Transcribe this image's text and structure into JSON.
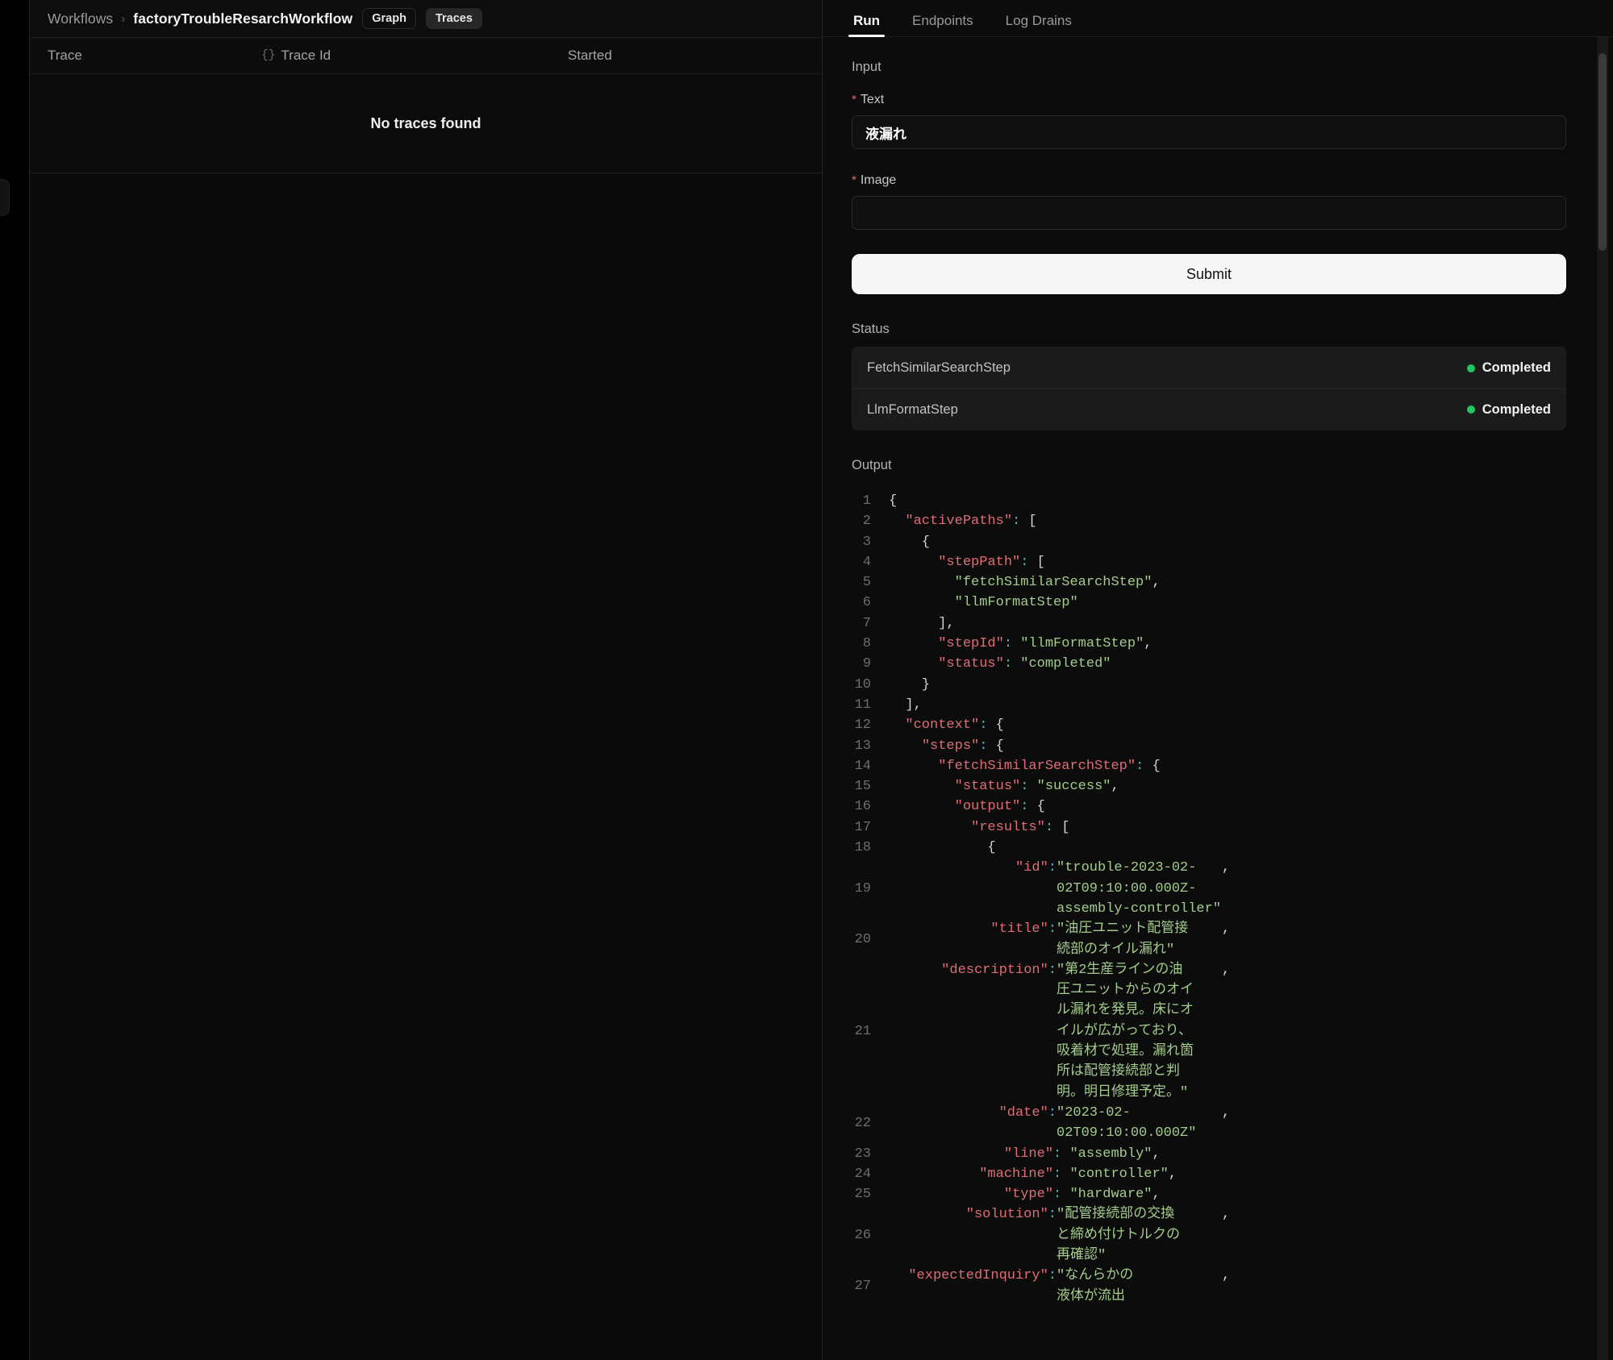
{
  "breadcrumb": {
    "root_label": "Workflows",
    "separator": "›",
    "current_label": "factoryTroubleResarchWorkflow",
    "graph_button": "Graph",
    "traces_button": "Traces"
  },
  "traces_table": {
    "columns": [
      "Trace",
      "Trace Id",
      "Started"
    ],
    "trace_id_prefix_icon": "{}",
    "empty_message": "No traces found"
  },
  "right_panel": {
    "tabs": [
      {
        "label": "Run",
        "active": true
      },
      {
        "label": "Endpoints",
        "active": false
      },
      {
        "label": "Log Drains",
        "active": false
      }
    ],
    "input_section_label": "Input",
    "fields": [
      {
        "label": "Text",
        "required_marker": "*",
        "value": "液漏れ",
        "placeholder": ""
      },
      {
        "label": "Image",
        "required_marker": "*",
        "value": "",
        "placeholder": ""
      }
    ],
    "submit_label": "Submit",
    "status_label": "Status",
    "status_rows": [
      {
        "step": "FetchSimilarSearchStep",
        "state": "Completed",
        "dot_color": "#22c55e"
      },
      {
        "step": "LlmFormatStep",
        "state": "Completed",
        "dot_color": "#22c55e"
      }
    ],
    "output_label": "Output"
  },
  "colors": {
    "accent_green": "#22c55e",
    "required_red": "#e06c75",
    "submit_bg": "#f7f7f7",
    "code_key": "#e06c75",
    "code_string": "#a3cc8c",
    "code_colon": "#56b6c2",
    "code_line_number": "#6e6e6e"
  },
  "output_code": {
    "language": "json",
    "lines": [
      {
        "n": "1",
        "segments": [
          {
            "t": "{",
            "c": "d"
          }
        ]
      },
      {
        "n": "2",
        "segments": [
          {
            "t": "  ",
            "c": "d"
          },
          {
            "t": "\"activePaths\"",
            "c": "k"
          },
          {
            "t": ":",
            "c": "p"
          },
          {
            "t": " [",
            "c": "d"
          }
        ]
      },
      {
        "n": "3",
        "segments": [
          {
            "t": "    {",
            "c": "d"
          }
        ]
      },
      {
        "n": "4",
        "segments": [
          {
            "t": "      ",
            "c": "d"
          },
          {
            "t": "\"stepPath\"",
            "c": "k"
          },
          {
            "t": ":",
            "c": "p"
          },
          {
            "t": " [",
            "c": "d"
          }
        ]
      },
      {
        "n": "5",
        "segments": [
          {
            "t": "        ",
            "c": "d"
          },
          {
            "t": "\"fetchSimilarSearchStep\"",
            "c": "s"
          },
          {
            "t": ",",
            "c": "d"
          }
        ]
      },
      {
        "n": "6",
        "segments": [
          {
            "t": "        ",
            "c": "d"
          },
          {
            "t": "\"llmFormatStep\"",
            "c": "s"
          }
        ]
      },
      {
        "n": "7",
        "segments": [
          {
            "t": "      ],",
            "c": "d"
          }
        ]
      },
      {
        "n": "8",
        "segments": [
          {
            "t": "      ",
            "c": "d"
          },
          {
            "t": "\"stepId\"",
            "c": "k"
          },
          {
            "t": ":",
            "c": "p"
          },
          {
            "t": " ",
            "c": "d"
          },
          {
            "t": "\"llmFormatStep\"",
            "c": "s"
          },
          {
            "t": ",",
            "c": "d"
          }
        ]
      },
      {
        "n": "9",
        "segments": [
          {
            "t": "      ",
            "c": "d"
          },
          {
            "t": "\"status\"",
            "c": "k"
          },
          {
            "t": ":",
            "c": "p"
          },
          {
            "t": " ",
            "c": "d"
          },
          {
            "t": "\"completed\"",
            "c": "s"
          }
        ]
      },
      {
        "n": "10",
        "segments": [
          {
            "t": "    }",
            "c": "d"
          }
        ]
      },
      {
        "n": "11",
        "segments": [
          {
            "t": "  ],",
            "c": "d"
          }
        ]
      },
      {
        "n": "12",
        "segments": [
          {
            "t": "  ",
            "c": "d"
          },
          {
            "t": "\"context\"",
            "c": "k"
          },
          {
            "t": ":",
            "c": "p"
          },
          {
            "t": " {",
            "c": "d"
          }
        ]
      },
      {
        "n": "13",
        "segments": [
          {
            "t": "    ",
            "c": "d"
          },
          {
            "t": "\"steps\"",
            "c": "k"
          },
          {
            "t": ":",
            "c": "p"
          },
          {
            "t": " {",
            "c": "d"
          }
        ]
      },
      {
        "n": "14",
        "segments": [
          {
            "t": "      ",
            "c": "d"
          },
          {
            "t": "\"fetchSimilarSearchStep\"",
            "c": "k"
          },
          {
            "t": ":",
            "c": "p"
          },
          {
            "t": " {",
            "c": "d"
          }
        ]
      },
      {
        "n": "15",
        "segments": [
          {
            "t": "        ",
            "c": "d"
          },
          {
            "t": "\"status\"",
            "c": "k"
          },
          {
            "t": ":",
            "c": "p"
          },
          {
            "t": " ",
            "c": "d"
          },
          {
            "t": "\"success\"",
            "c": "s"
          },
          {
            "t": ",",
            "c": "d"
          }
        ]
      },
      {
        "n": "16",
        "segments": [
          {
            "t": "        ",
            "c": "d"
          },
          {
            "t": "\"output\"",
            "c": "k"
          },
          {
            "t": ":",
            "c": "p"
          },
          {
            "t": " {",
            "c": "d"
          }
        ]
      },
      {
        "n": "17",
        "segments": [
          {
            "t": "          ",
            "c": "d"
          },
          {
            "t": "\"results\"",
            "c": "k"
          },
          {
            "t": ":",
            "c": "p"
          },
          {
            "t": " [",
            "c": "d"
          }
        ]
      },
      {
        "n": "18",
        "segments": [
          {
            "t": "            {",
            "c": "d"
          }
        ]
      }
    ],
    "wrapped_lines": [
      {
        "n": "19",
        "key": "\"id\"",
        "value_lines": [
          "\"trouble-2023-02-",
          "02T09:10:00.000Z-",
          "assembly-controller\""
        ],
        "tail": ","
      },
      {
        "n": "20",
        "key": "\"title\"",
        "value_lines": [
          "\"油圧ユニット配管接",
          "続部のオイル漏れ\""
        ],
        "tail": ","
      },
      {
        "n": "21",
        "key": "\"description\"",
        "value_lines": [
          "\"第2生産ラインの油",
          "圧ユニットからのオイ",
          "ル漏れを発見。床にオ",
          "イルが広がっており、",
          "吸着材で処理。漏れ箇",
          "所は配管接続部と判",
          "明。明日修理予定。\""
        ],
        "tail": ","
      },
      {
        "n": "22",
        "key": "\"date\"",
        "value_lines": [
          "\"2023-02-",
          "02T09:10:00.000Z\""
        ],
        "tail": ","
      }
    ],
    "lines_tail": [
      {
        "n": "23",
        "segments": [
          {
            "t": "              ",
            "c": "d"
          },
          {
            "t": "\"line\"",
            "c": "k"
          },
          {
            "t": ":",
            "c": "p"
          },
          {
            "t": " ",
            "c": "d"
          },
          {
            "t": "\"assembly\"",
            "c": "s"
          },
          {
            "t": ",",
            "c": "d"
          }
        ]
      },
      {
        "n": "24",
        "segments": [
          {
            "t": "           ",
            "c": "d"
          },
          {
            "t": "\"machine\"",
            "c": "k"
          },
          {
            "t": ":",
            "c": "p"
          },
          {
            "t": " ",
            "c": "d"
          },
          {
            "t": "\"controller\"",
            "c": "s"
          },
          {
            "t": ",",
            "c": "d"
          }
        ]
      },
      {
        "n": "25",
        "segments": [
          {
            "t": "              ",
            "c": "d"
          },
          {
            "t": "\"type\"",
            "c": "k"
          },
          {
            "t": ":",
            "c": "p"
          },
          {
            "t": " ",
            "c": "d"
          },
          {
            "t": "\"hardware\"",
            "c": "s"
          },
          {
            "t": ",",
            "c": "d"
          }
        ]
      }
    ],
    "wrapped_lines_tail": [
      {
        "n": "26",
        "key": "\"solution\"",
        "value_lines": [
          "\"配管接続部の交換",
          "と締め付けトルクの",
          "再確認\""
        ],
        "tail": ","
      },
      {
        "n": "27",
        "key": "\"expectedInquiry\"",
        "value_lines": [
          "\"なんらかの",
          "液体が流出"
        ],
        "tail": ","
      }
    ]
  }
}
